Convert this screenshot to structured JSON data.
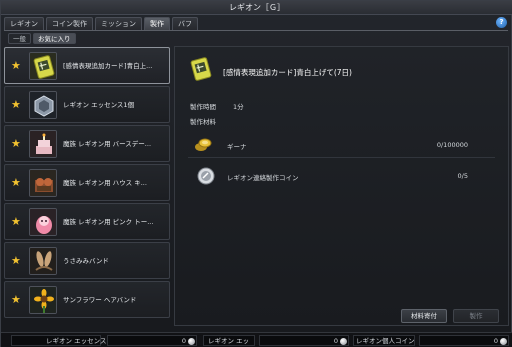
{
  "window": {
    "title": "レギオン［Ｇ］"
  },
  "tabs": [
    {
      "label": "レギオン"
    },
    {
      "label": "コイン製作"
    },
    {
      "label": "ミッション"
    },
    {
      "label": "製作"
    },
    {
      "label": "バフ"
    }
  ],
  "subtabs": [
    {
      "label": "一般"
    },
    {
      "label": "お気に入り"
    }
  ],
  "help_label": "?",
  "items": [
    {
      "name": "[感情表現追加カード]青白上..."
    },
    {
      "name": "レギオン エッセンス1個"
    },
    {
      "name": "魔族 レギオン用 バースデー..."
    },
    {
      "name": "魔族 レギオン用 ハウス キ..."
    },
    {
      "name": "魔族 レギオン用 ピンク トー..."
    },
    {
      "name": "うさみみバンド"
    },
    {
      "name": "サンフラワー ヘアバンド"
    }
  ],
  "detail": {
    "title": "[感情表現追加カード]青白上げて(7日)",
    "time_label": "製作時間",
    "time_value": "1分",
    "materials_label": "製作材料",
    "materials": [
      {
        "name": "ギーナ",
        "count": "0/100000"
      },
      {
        "name": "レギオン連絡製作コイン",
        "count": "0/5"
      }
    ],
    "donate_button": "材料寄付",
    "craft_button": "製作"
  },
  "footer": [
    {
      "label": "レギオン エッセンス",
      "value": "0"
    },
    {
      "label": "レギオン エッ",
      "value": "0"
    },
    {
      "label": "レギオン個人コイン",
      "value": "0"
    }
  ],
  "colors": {
    "star": "#f2c230",
    "accent_blue": "#3f8fe0"
  }
}
